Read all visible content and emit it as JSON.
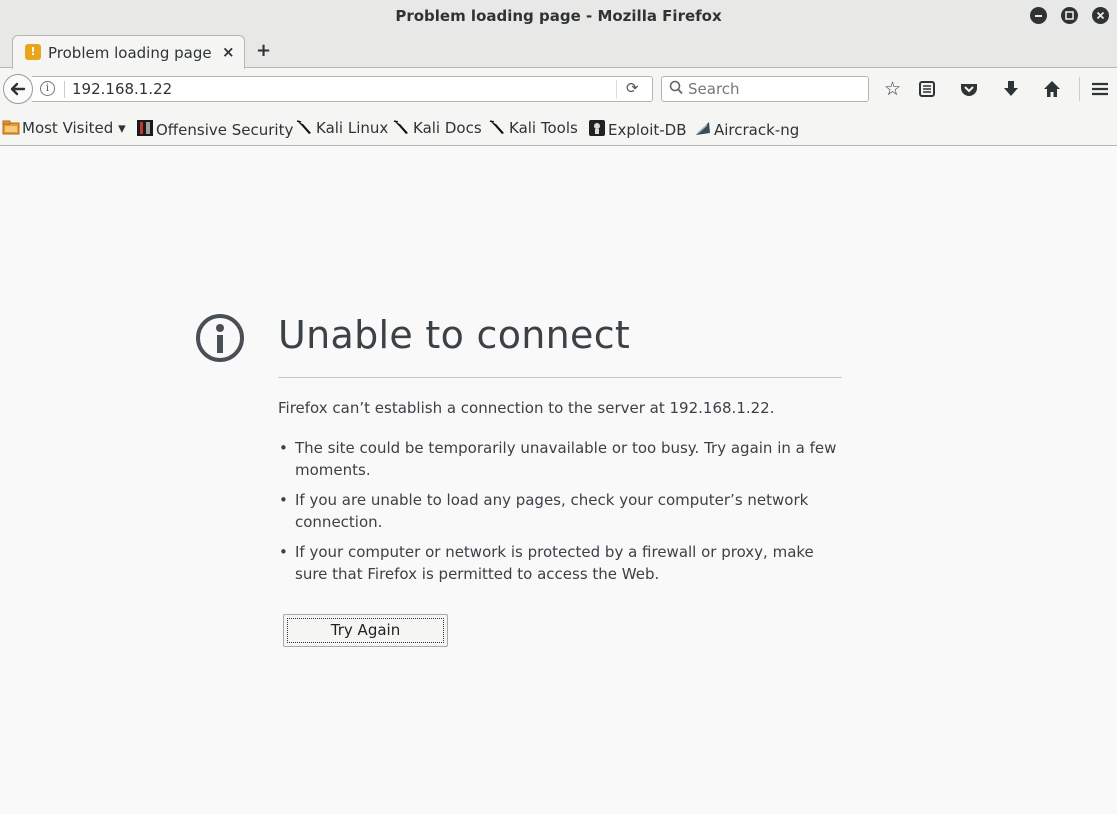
{
  "window": {
    "title": "Problem loading page - Mozilla Firefox"
  },
  "tab": {
    "title": "Problem loading page",
    "close": "×",
    "new_tab": "+"
  },
  "navbar": {
    "url": "192.168.1.22",
    "info": "i",
    "reload": "⟳",
    "search_placeholder": "Search",
    "search_glyph": "🔍"
  },
  "toolbar": {
    "bookmark_star": "☆",
    "reading_list": "▤",
    "pocket": "⛉",
    "downloads": "⬇",
    "home": "⌂",
    "menu": "≡"
  },
  "bookmarks": [
    {
      "label": "Most Visited ▾",
      "icon": "folder-icon"
    },
    {
      "label": "Offensive Security",
      "icon": "offsec-icon"
    },
    {
      "label": "Kali Linux",
      "icon": "kali-dragon-icon"
    },
    {
      "label": "Kali Docs",
      "icon": "kali-dragon-icon"
    },
    {
      "label": "Kali Tools",
      "icon": "kali-dragon-icon"
    },
    {
      "label": "Exploit-DB",
      "icon": "exploitdb-icon"
    },
    {
      "label": "Aircrack-ng",
      "icon": "aircrack-icon"
    }
  ],
  "error": {
    "title": "Unable to connect",
    "description": "Firefox can’t establish a connection to the server at 192.168.1.22.",
    "items": [
      "The site could be temporarily unavailable or too busy. Try again in a few moments.",
      "If you are unable to load any pages, check your computer’s network connection.",
      "If your computer or network is protected by a firewall or proxy, make sure that Firefox is permitted to access the Web."
    ],
    "button": "Try Again"
  }
}
